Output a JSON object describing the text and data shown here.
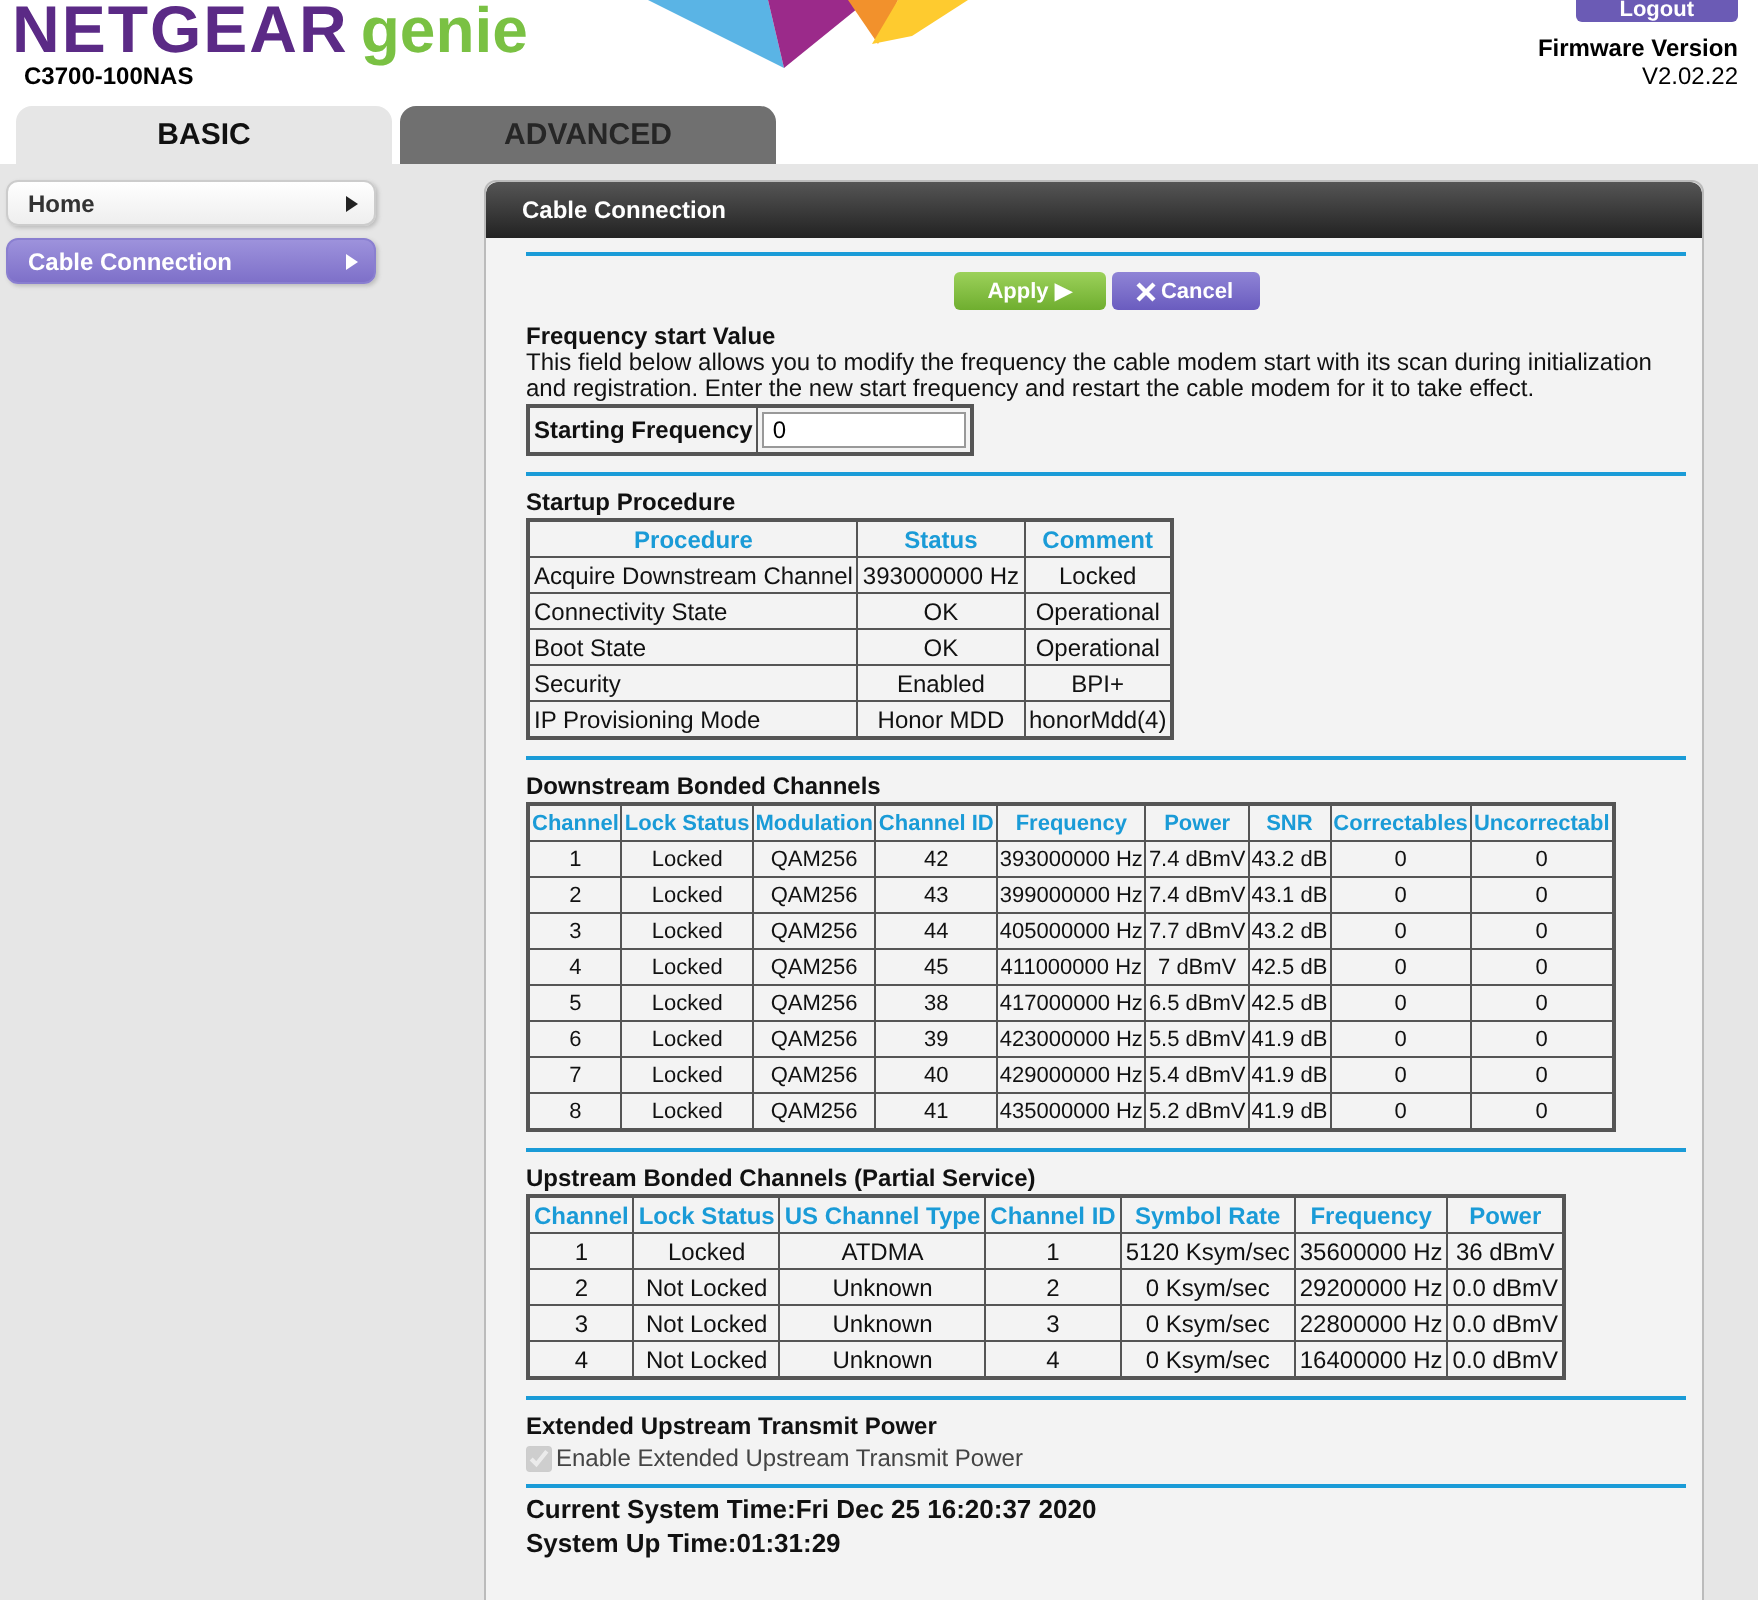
{
  "header": {
    "brand": "NETGEAR",
    "product": "genie",
    "model": "C3700-100NAS",
    "logout": "Logout",
    "firmware_label": "Firmware Version",
    "firmware_version": "V2.02.22"
  },
  "tabs": [
    {
      "label": "BASIC",
      "selected": true
    },
    {
      "label": "ADVANCED",
      "selected": false
    }
  ],
  "sidebar": {
    "items": [
      {
        "label": "Home",
        "selected": false
      },
      {
        "label": "Cable Connection",
        "selected": true
      }
    ]
  },
  "panel": {
    "title": "Cable Connection",
    "apply": "Apply ▶",
    "cancel": "Cancel",
    "frequency": {
      "heading": "Frequency start Value",
      "description": "This field below allows you to modify the frequency the cable modem start with its scan during initialization and registration. Enter the new start frequency and restart the cable modem for it to take effect.",
      "label": "Starting Frequency",
      "value": "0"
    },
    "startup": {
      "heading": "Startup Procedure",
      "columns": [
        "Procedure",
        "Status",
        "Comment"
      ],
      "rows": [
        [
          "Acquire Downstream Channel",
          "393000000 Hz",
          "Locked"
        ],
        [
          "Connectivity State",
          "OK",
          "Operational"
        ],
        [
          "Boot State",
          "OK",
          "Operational"
        ],
        [
          "Security",
          "Enabled",
          "BPI+"
        ],
        [
          "IP Provisioning Mode",
          "Honor MDD",
          "honorMdd(4)"
        ]
      ]
    },
    "downstream": {
      "heading": "Downstream Bonded Channels",
      "columns": [
        "Channel",
        "Lock Status",
        "Modulation",
        "Channel ID",
        "Frequency",
        "Power",
        "SNR",
        "Correctables",
        "Uncorrectabl"
      ],
      "rows": [
        [
          "1",
          "Locked",
          "QAM256",
          "42",
          "393000000 Hz",
          "7.4 dBmV",
          "43.2 dB",
          "0",
          "0"
        ],
        [
          "2",
          "Locked",
          "QAM256",
          "43",
          "399000000 Hz",
          "7.4 dBmV",
          "43.1 dB",
          "0",
          "0"
        ],
        [
          "3",
          "Locked",
          "QAM256",
          "44",
          "405000000 Hz",
          "7.7 dBmV",
          "43.2 dB",
          "0",
          "0"
        ],
        [
          "4",
          "Locked",
          "QAM256",
          "45",
          "411000000 Hz",
          "7 dBmV",
          "42.5 dB",
          "0",
          "0"
        ],
        [
          "5",
          "Locked",
          "QAM256",
          "38",
          "417000000 Hz",
          "6.5 dBmV",
          "42.5 dB",
          "0",
          "0"
        ],
        [
          "6",
          "Locked",
          "QAM256",
          "39",
          "423000000 Hz",
          "5.5 dBmV",
          "41.9 dB",
          "0",
          "0"
        ],
        [
          "7",
          "Locked",
          "QAM256",
          "40",
          "429000000 Hz",
          "5.4 dBmV",
          "41.9 dB",
          "0",
          "0"
        ],
        [
          "8",
          "Locked",
          "QAM256",
          "41",
          "435000000 Hz",
          "5.2 dBmV",
          "41.9 dB",
          "0",
          "0"
        ]
      ]
    },
    "upstream": {
      "heading": "Upstream Bonded Channels (Partial Service)",
      "columns": [
        "Channel",
        "Lock Status",
        "US Channel Type",
        "Channel ID",
        "Symbol Rate",
        "Frequency",
        "Power"
      ],
      "rows": [
        [
          "1",
          "Locked",
          "ATDMA",
          "1",
          "5120 Ksym/sec",
          "35600000 Hz",
          "36 dBmV"
        ],
        [
          "2",
          "Not Locked",
          "Unknown",
          "2",
          "0 Ksym/sec",
          "29200000 Hz",
          "0.0 dBmV"
        ],
        [
          "3",
          "Not Locked",
          "Unknown",
          "3",
          "0 Ksym/sec",
          "22800000 Hz",
          "0.0 dBmV"
        ],
        [
          "4",
          "Not Locked",
          "Unknown",
          "4",
          "0 Ksym/sec",
          "16400000 Hz",
          "0.0 dBmV"
        ]
      ]
    },
    "extended": {
      "heading": "Extended Upstream Transmit Power",
      "label": "Enable Extended Upstream Transmit Power",
      "checked": true,
      "disabled": true
    },
    "system_time": "Current System Time:Fri Dec 25 16:20:37 2020",
    "uptime": "System Up Time:01:31:29"
  }
}
